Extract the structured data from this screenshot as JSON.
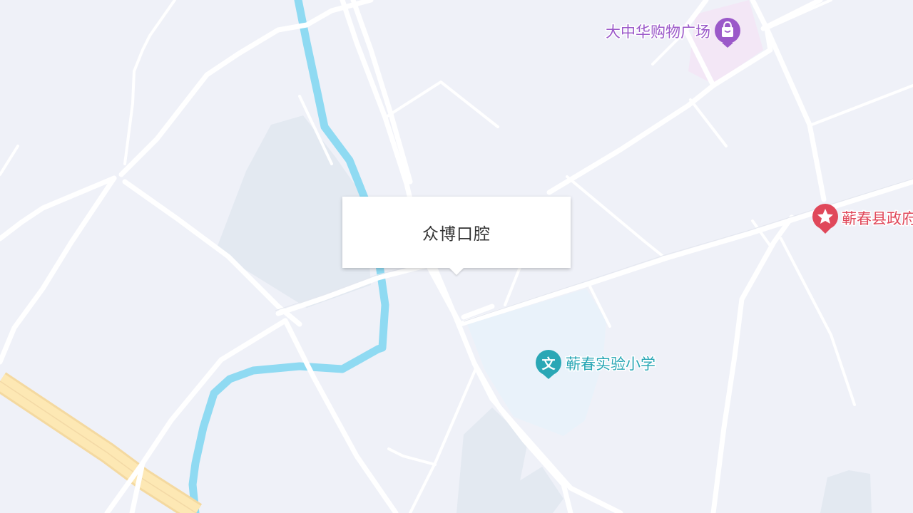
{
  "map": {
    "background_color": "#eff1f8",
    "road_color": "#ffffff",
    "river_color": "#8fdaf2",
    "highway_color": "#fde3a7",
    "park_color": "#e3e9f1"
  },
  "popup": {
    "title": "众博口腔"
  },
  "pois": [
    {
      "name": "大中华购物广场",
      "icon": "shopping-bag-icon",
      "color": "#9b59c9"
    },
    {
      "name": "蕲春实验小学",
      "icon": "school-wen-icon",
      "color": "#2aa7b5"
    },
    {
      "name": "蕲春县政府",
      "icon": "government-star-icon",
      "color": "#e0485a"
    }
  ]
}
